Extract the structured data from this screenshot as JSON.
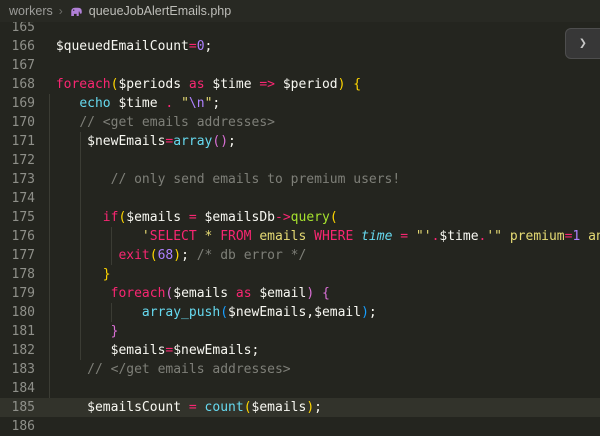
{
  "breadcrumb": {
    "folder": "workers",
    "separator": "›",
    "file": "queueJobAlertEmails.php",
    "file_icon": "php-elephant"
  },
  "overlay_button": {
    "glyph": "❯"
  },
  "colors": {
    "bg": "#24251f",
    "breadcrumbBg": "#282923",
    "breadcrumbFg": "#9d9d9a",
    "breadcrumbSep": "#6f6f6b",
    "breadcrumbFileFg": "#bdbdb8",
    "phpIcon": "#b180d7",
    "fg": "#f8f8f2",
    "pink": "#f92672",
    "cyan": "#66d9ef",
    "green": "#a6e22e",
    "purple": "#ae81ff",
    "yellow": "#e6db74",
    "comment": "#7e7f78",
    "lineNumber": "#8f908a",
    "currentLine": "#32332b",
    "indentGuide": "#3b3c34",
    "bracket1": "#ffd700",
    "bracket2": "#da70d6",
    "bracket3": "#179fff",
    "overlayBtnBg": "#373737",
    "overlayBtnBorder": "#4e4e4e",
    "overlayBtnFg": "#c8c8c8"
  },
  "code": {
    "language": "php",
    "lines": [
      {
        "n": "165",
        "s": []
      },
      {
        "n": "166",
        "s": [
          {
            "t": " $queuedEmailCount",
            "c": "w"
          },
          {
            "t": "=",
            "c": "p"
          },
          {
            "t": "0",
            "c": "n"
          },
          {
            "t": ";",
            "c": "w"
          }
        ]
      },
      {
        "n": "167",
        "s": []
      },
      {
        "n": "168",
        "s": [
          {
            "t": " ",
            "c": "w"
          },
          {
            "t": "foreach",
            "c": "p"
          },
          {
            "t": "(",
            "c": "b1"
          },
          {
            "t": "$periods ",
            "c": "w"
          },
          {
            "t": "as",
            "c": "p"
          },
          {
            "t": " $time ",
            "c": "w"
          },
          {
            "t": "=>",
            "c": "p"
          },
          {
            "t": " $period",
            "c": "w"
          },
          {
            "t": ")",
            "c": "b1"
          },
          {
            "t": " ",
            "c": "w"
          },
          {
            "t": "{",
            "c": "b1"
          }
        ]
      },
      {
        "n": "169",
        "s": [
          {
            "t": "    ",
            "c": "w"
          },
          {
            "t": "echo",
            "c": "c"
          },
          {
            "t": " $time ",
            "c": "w"
          },
          {
            "t": ".",
            "c": "p"
          },
          {
            "t": " ",
            "c": "w"
          },
          {
            "t": "\"",
            "c": "s"
          },
          {
            "t": "\\n",
            "c": "n"
          },
          {
            "t": "\"",
            "c": "s"
          },
          {
            "t": ";",
            "c": "w"
          }
        ],
        "gd": [
          0
        ]
      },
      {
        "n": "170",
        "s": [
          {
            "t": "    ",
            "c": "w"
          },
          {
            "t": "// <get emails addresses>",
            "c": "m"
          }
        ],
        "gd": [
          0
        ]
      },
      {
        "n": "171",
        "s": [
          {
            "t": "     $newEmails",
            "c": "w"
          },
          {
            "t": "=",
            "c": "p"
          },
          {
            "t": "array",
            "c": "c"
          },
          {
            "t": "(",
            "c": "b2"
          },
          {
            "t": ")",
            "c": "b2"
          },
          {
            "t": ";",
            "c": "w"
          }
        ],
        "gd": [
          0,
          4
        ]
      },
      {
        "n": "172",
        "s": [],
        "gd": [
          0,
          4
        ]
      },
      {
        "n": "173",
        "s": [
          {
            "t": "        ",
            "c": "w"
          },
          {
            "t": "// only send emails to premium users!",
            "c": "m"
          }
        ],
        "gd": [
          0,
          4
        ]
      },
      {
        "n": "174",
        "s": [],
        "gd": [
          0,
          4
        ]
      },
      {
        "n": "175",
        "s": [
          {
            "t": "       ",
            "c": "w"
          },
          {
            "t": "if",
            "c": "p"
          },
          {
            "t": "(",
            "c": "b1"
          },
          {
            "t": "$emails ",
            "c": "w"
          },
          {
            "t": "=",
            "c": "p"
          },
          {
            "t": " $emailsDb",
            "c": "w"
          },
          {
            "t": "->",
            "c": "p"
          },
          {
            "t": "query",
            "c": "g"
          },
          {
            "t": "(",
            "c": "b1"
          }
        ],
        "gd": [
          0,
          4
        ]
      },
      {
        "n": "176",
        "s": [
          {
            "t": "            ",
            "c": "w"
          },
          {
            "t": "'",
            "c": "s"
          },
          {
            "t": "SELECT",
            "c": "p"
          },
          {
            "t": " * ",
            "c": "s"
          },
          {
            "t": "FROM",
            "c": "p"
          },
          {
            "t": " emails ",
            "c": "s"
          },
          {
            "t": "WHERE",
            "c": "p"
          },
          {
            "t": " ",
            "c": "s"
          },
          {
            "t": "time",
            "c": "ci"
          },
          {
            "t": " ",
            "c": "s"
          },
          {
            "t": "=",
            "c": "p"
          },
          {
            "t": " ",
            "c": "s"
          },
          {
            "t": "\"'",
            "c": "s"
          },
          {
            "t": ".",
            "c": "p"
          },
          {
            "t": "$time",
            "c": "w"
          },
          {
            "t": ".",
            "c": "p"
          },
          {
            "t": "'\"",
            "c": "s"
          },
          {
            "t": " premium",
            "c": "s"
          },
          {
            "t": "=",
            "c": "p"
          },
          {
            "t": "1",
            "c": "n"
          },
          {
            "t": " and",
            "c": "s"
          }
        ],
        "gd": [
          0,
          4,
          8
        ]
      },
      {
        "n": "177",
        "s": [
          {
            "t": "         ",
            "c": "w"
          },
          {
            "t": "exit",
            "c": "p"
          },
          {
            "t": "(",
            "c": "b1"
          },
          {
            "t": "68",
            "c": "n"
          },
          {
            "t": ")",
            "c": "b1"
          },
          {
            "t": ";",
            "c": "w"
          },
          {
            "t": " /* db error */",
            "c": "m"
          }
        ],
        "gd": [
          0,
          4,
          8
        ]
      },
      {
        "n": "178",
        "s": [
          {
            "t": "       ",
            "c": "w"
          },
          {
            "t": "}",
            "c": "b1"
          }
        ],
        "gd": [
          0,
          4
        ]
      },
      {
        "n": "179",
        "s": [
          {
            "t": "        ",
            "c": "w"
          },
          {
            "t": "foreach",
            "c": "p"
          },
          {
            "t": "(",
            "c": "b2"
          },
          {
            "t": "$emails ",
            "c": "w"
          },
          {
            "t": "as",
            "c": "p"
          },
          {
            "t": " $email",
            "c": "w"
          },
          {
            "t": ")",
            "c": "b2"
          },
          {
            "t": " ",
            "c": "w"
          },
          {
            "t": "{",
            "c": "b2"
          }
        ],
        "gd": [
          0,
          4
        ]
      },
      {
        "n": "180",
        "s": [
          {
            "t": "            ",
            "c": "w"
          },
          {
            "t": "array_push",
            "c": "c"
          },
          {
            "t": "(",
            "c": "b3"
          },
          {
            "t": "$newEmails,$email",
            "c": "w"
          },
          {
            "t": ")",
            "c": "b3"
          },
          {
            "t": ";",
            "c": "w"
          }
        ],
        "gd": [
          0,
          4,
          8
        ]
      },
      {
        "n": "181",
        "s": [
          {
            "t": "        ",
            "c": "w"
          },
          {
            "t": "}",
            "c": "b2"
          }
        ],
        "gd": [
          0,
          4
        ]
      },
      {
        "n": "182",
        "s": [
          {
            "t": "        $emails",
            "c": "w"
          },
          {
            "t": "=",
            "c": "p"
          },
          {
            "t": "$newEmails;",
            "c": "w"
          }
        ],
        "gd": [
          0,
          4
        ]
      },
      {
        "n": "183",
        "s": [
          {
            "t": "     ",
            "c": "w"
          },
          {
            "t": "// </get emails addresses>",
            "c": "m"
          }
        ],
        "gd": [
          0
        ]
      },
      {
        "n": "184",
        "s": [],
        "gd": [
          0
        ]
      },
      {
        "n": "185",
        "current": true,
        "s": [
          {
            "t": "     $emailsCount ",
            "c": "w"
          },
          {
            "t": "=",
            "c": "p"
          },
          {
            "t": " ",
            "c": "w"
          },
          {
            "t": "count",
            "c": "c"
          },
          {
            "t": "(",
            "c": "b1"
          },
          {
            "t": "$emails",
            "c": "w"
          },
          {
            "t": ")",
            "c": "b1"
          },
          {
            "t": ";",
            "c": "w"
          }
        ]
      },
      {
        "n": "186",
        "s": []
      }
    ]
  }
}
